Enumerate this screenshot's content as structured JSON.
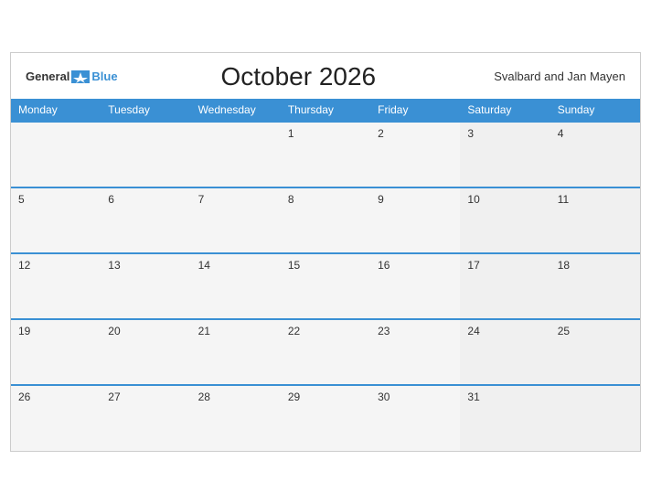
{
  "header": {
    "logo_general": "General",
    "logo_blue": "Blue",
    "month_title": "October 2026",
    "region": "Svalbard and Jan Mayen"
  },
  "weekdays": [
    "Monday",
    "Tuesday",
    "Wednesday",
    "Thursday",
    "Friday",
    "Saturday",
    "Sunday"
  ],
  "weeks": [
    [
      {
        "day": "",
        "empty": true
      },
      {
        "day": "",
        "empty": true
      },
      {
        "day": "",
        "empty": true
      },
      {
        "day": "1",
        "empty": false
      },
      {
        "day": "2",
        "empty": false
      },
      {
        "day": "3",
        "empty": false
      },
      {
        "day": "4",
        "empty": false
      }
    ],
    [
      {
        "day": "5",
        "empty": false
      },
      {
        "day": "6",
        "empty": false
      },
      {
        "day": "7",
        "empty": false
      },
      {
        "day": "8",
        "empty": false
      },
      {
        "day": "9",
        "empty": false
      },
      {
        "day": "10",
        "empty": false
      },
      {
        "day": "11",
        "empty": false
      }
    ],
    [
      {
        "day": "12",
        "empty": false
      },
      {
        "day": "13",
        "empty": false
      },
      {
        "day": "14",
        "empty": false
      },
      {
        "day": "15",
        "empty": false
      },
      {
        "day": "16",
        "empty": false
      },
      {
        "day": "17",
        "empty": false
      },
      {
        "day": "18",
        "empty": false
      }
    ],
    [
      {
        "day": "19",
        "empty": false
      },
      {
        "day": "20",
        "empty": false
      },
      {
        "day": "21",
        "empty": false
      },
      {
        "day": "22",
        "empty": false
      },
      {
        "day": "23",
        "empty": false
      },
      {
        "day": "24",
        "empty": false
      },
      {
        "day": "25",
        "empty": false
      }
    ],
    [
      {
        "day": "26",
        "empty": false
      },
      {
        "day": "27",
        "empty": false
      },
      {
        "day": "28",
        "empty": false
      },
      {
        "day": "29",
        "empty": false
      },
      {
        "day": "30",
        "empty": false
      },
      {
        "day": "31",
        "empty": false
      },
      {
        "day": "",
        "empty": true
      }
    ]
  ]
}
